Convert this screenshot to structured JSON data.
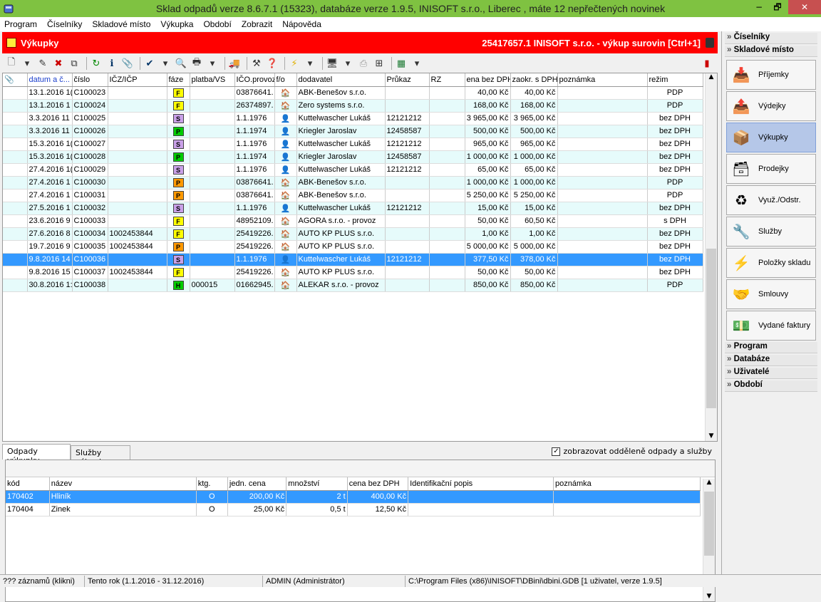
{
  "window": {
    "title": "Sklad odpadů verze 8.6.7.1 (15323), databáze verze 1.9.5, INISOFT s.r.o., Liberec , máte 12 nepřečtených novinek",
    "min": "−",
    "max": "🗗",
    "close": "✕"
  },
  "menu": [
    "Program",
    "Číselníky",
    "Skladové místo",
    "Výkupka",
    "Období",
    "Zobrazit",
    "Nápověda"
  ],
  "header": {
    "title": "Výkupky",
    "right": "25417657.1 INISOFT s.r.o. - výkup surovin [Ctrl+1]"
  },
  "colors": {
    "accent": "#ff0000",
    "titlebar": "#7fc241",
    "selection": "#3399ff",
    "alt_row": "#e6fbfb"
  },
  "grid": {
    "columns": [
      "datum a č...",
      "číslo",
      "IČZ/IČP",
      "fáze",
      "platba/VS",
      "IČO.provoz",
      "f/o",
      "dodavatel",
      "Průkaz",
      "RZ",
      "ena bez DPH",
      "zaokr. s DPH",
      "poznámka",
      "režim"
    ],
    "rows": [
      {
        "date": "13.1.2016 1(",
        "num": "C100023",
        "icz": "",
        "phase": "F",
        "pc": "#ffff00",
        "vs": "",
        "ico": "03876641.",
        "fo": "🏠",
        "sup": "ABK-Benešov s.r.o.",
        "pr": "",
        "rz": "",
        "net": "40,00 Kč",
        "gross": "40,00 Kč",
        "note": "",
        "mode": "PDP"
      },
      {
        "date": "13.1.2016 1",
        "num": "C100024",
        "icz": "",
        "phase": "F",
        "pc": "#ffff00",
        "vs": "",
        "ico": "26374897.",
        "fo": "🏠",
        "sup": "Zero systems s.r.o.",
        "pr": "",
        "rz": "",
        "net": "168,00 Kč",
        "gross": "168,00 Kč",
        "note": "",
        "mode": "PDP"
      },
      {
        "date": "3.3.2016 11",
        "num": "C100025",
        "icz": "",
        "phase": "S",
        "pc": "#c9a0e8",
        "vs": "",
        "ico": "1.1.1976",
        "fo": "👤",
        "sup": "Kuttelwascher Lukáš",
        "pr": "12121212",
        "rz": "",
        "net": "3 965,00 Kč",
        "gross": "3 965,00 Kč",
        "note": "",
        "mode": "bez DPH"
      },
      {
        "date": "3.3.2016 11",
        "num": "C100026",
        "icz": "",
        "phase": "P",
        "pc": "#00cc00",
        "vs": "",
        "ico": "1.1.1974",
        "fo": "👤",
        "sup": "Kriegler Jaroslav",
        "pr": "12458587",
        "rz": "",
        "net": "500,00 Kč",
        "gross": "500,00 Kč",
        "note": "",
        "mode": "bez DPH"
      },
      {
        "date": "15.3.2016 1(",
        "num": "C100027",
        "icz": "",
        "phase": "S",
        "pc": "#c9a0e8",
        "vs": "",
        "ico": "1.1.1976",
        "fo": "👤",
        "sup": "Kuttelwascher Lukáš",
        "pr": "12121212",
        "rz": "",
        "net": "965,00 Kč",
        "gross": "965,00 Kč",
        "note": "",
        "mode": "bez DPH"
      },
      {
        "date": "15.3.2016 1(",
        "num": "C100028",
        "icz": "",
        "phase": "P",
        "pc": "#00cc00",
        "vs": "",
        "ico": "1.1.1974",
        "fo": "👤",
        "sup": "Kriegler Jaroslav",
        "pr": "12458587",
        "rz": "",
        "net": "1 000,00 Kč",
        "gross": "1 000,00 Kč",
        "note": "",
        "mode": "bez DPH"
      },
      {
        "date": "27.4.2016 1(",
        "num": "C100029",
        "icz": "",
        "phase": "S",
        "pc": "#c9a0e8",
        "vs": "",
        "ico": "1.1.1976",
        "fo": "👤",
        "sup": "Kuttelwascher Lukáš",
        "pr": "12121212",
        "rz": "",
        "net": "65,00 Kč",
        "gross": "65,00 Kč",
        "note": "",
        "mode": "bez DPH"
      },
      {
        "date": "27.4.2016 1",
        "num": "C100030",
        "icz": "",
        "phase": "P",
        "pc": "#ff9900",
        "vs": "",
        "ico": "03876641.",
        "fo": "🏠",
        "sup": "ABK-Benešov s.r.o.",
        "pr": "",
        "rz": "",
        "net": "1 000,00 Kč",
        "gross": "1 000,00 Kč",
        "note": "",
        "mode": "PDP"
      },
      {
        "date": "27.4.2016 1",
        "num": "C100031",
        "icz": "",
        "phase": "P",
        "pc": "#ff9900",
        "vs": "",
        "ico": "03876641.",
        "fo": "🏠",
        "sup": "ABK-Benešov s.r.o.",
        "pr": "",
        "rz": "",
        "net": "5 250,00 Kč",
        "gross": "5 250,00 Kč",
        "note": "",
        "mode": "PDP"
      },
      {
        "date": "27.5.2016 1",
        "num": "C100032",
        "icz": "",
        "phase": "S",
        "pc": "#c9a0e8",
        "vs": "",
        "ico": "1.1.1976",
        "fo": "👤",
        "sup": "Kuttelwascher Lukáš",
        "pr": "12121212",
        "rz": "",
        "net": "15,00 Kč",
        "gross": "15,00 Kč",
        "note": "",
        "mode": "bez DPH"
      },
      {
        "date": "23.6.2016 9",
        "num": "C100033",
        "icz": "",
        "phase": "F",
        "pc": "#ffff00",
        "vs": "",
        "ico": "48952109.",
        "fo": "🏠",
        "sup": "AGORA s.r.o. - provoz",
        "pr": "",
        "rz": "",
        "net": "50,00 Kč",
        "gross": "60,50 Kč",
        "note": "",
        "mode": "s DPH"
      },
      {
        "date": "27.6.2016 8",
        "num": "C100034",
        "icz": "1002453844",
        "phase": "F",
        "pc": "#ffff00",
        "vs": "",
        "ico": "25419226.",
        "fo": "🏠",
        "sup": "AUTO KP PLUS s.r.o.",
        "pr": "",
        "rz": "",
        "net": "1,00 Kč",
        "gross": "1,00 Kč",
        "note": "",
        "mode": "bez DPH"
      },
      {
        "date": "19.7.2016 9",
        "num": "C100035",
        "icz": "1002453844",
        "phase": "P",
        "pc": "#ff9900",
        "vs": "",
        "ico": "25419226.",
        "fo": "🏠",
        "sup": "AUTO KP PLUS s.r.o.",
        "pr": "",
        "rz": "",
        "net": "5 000,00 Kč",
        "gross": "5 000,00 Kč",
        "note": "",
        "mode": "bez DPH"
      },
      {
        "date": "9.8.2016 14",
        "num": "C100036",
        "icz": "",
        "phase": "S",
        "pc": "#c9a0e8",
        "vs": "",
        "ico": "1.1.1976",
        "fo": "👤",
        "sup": "Kuttelwascher Lukáš",
        "pr": "12121212",
        "rz": "",
        "net": "377,50 Kč",
        "gross": "378,00 Kč",
        "note": "",
        "mode": "bez DPH",
        "selected": true
      },
      {
        "date": "9.8.2016 15",
        "num": "C100037",
        "icz": "1002453844",
        "phase": "F",
        "pc": "#ffff00",
        "vs": "",
        "ico": "25419226.",
        "fo": "🏠",
        "sup": "AUTO KP PLUS s.r.o.",
        "pr": "",
        "rz": "",
        "net": "50,00 Kč",
        "gross": "50,00 Kč",
        "note": "",
        "mode": "bez DPH"
      },
      {
        "date": "30.8.2016 1:",
        "num": "C100038",
        "icz": "",
        "phase": "H",
        "pc": "#00cc00",
        "vs": "000015",
        "ico": "01662945.",
        "fo": "🏠",
        "sup": "ALEKAR s.r.o. - provoz",
        "pr": "",
        "rz": "",
        "net": "850,00 Kč",
        "gross": "850,00 Kč",
        "note": "",
        "mode": "PDP"
      }
    ]
  },
  "tabs": [
    "Odpady výkupky",
    "Služby výkupky"
  ],
  "checkbox": {
    "label": "zobrazovat odděleně odpady a služby",
    "checked": "✓"
  },
  "grid2": {
    "columns": [
      "kód",
      "název",
      "ktg.",
      "jedn. cena",
      "množství",
      "cena bez DPH",
      "Identifikační popis",
      "poznámka"
    ],
    "rows": [
      {
        "code": "170402",
        "name": "Hliník",
        "ktg": "O",
        "unit": "200,00 Kč",
        "qty": "2 t",
        "net": "400,00 Kč",
        "id": "",
        "note": "",
        "selected": true
      },
      {
        "code": "170404",
        "name": "Zinek",
        "ktg": "O",
        "unit": "25,00 Kč",
        "qty": "0,5 t",
        "net": "12,50 Kč",
        "id": "",
        "note": ""
      }
    ]
  },
  "sidebar": {
    "sections_top": [
      "Číselníky",
      "Skladové místo"
    ],
    "buttons": [
      {
        "label": "Příjemky",
        "icon": "📥"
      },
      {
        "label": "Výdejky",
        "icon": "📤"
      },
      {
        "label": "Výkupky",
        "icon": "📦",
        "active": true
      },
      {
        "label": "Prodejky",
        "icon": "🗃"
      },
      {
        "label": "Využ./Odstr.",
        "icon": "♻"
      },
      {
        "label": "Služby",
        "icon": "🔧"
      },
      {
        "label": "Položky skladu",
        "icon": "⚡"
      },
      {
        "label": "Smlouvy",
        "icon": "🤝"
      },
      {
        "label": "Vydané faktury",
        "icon": "💵"
      }
    ],
    "sections_bottom": [
      "Program",
      "Databáze",
      "Uživatelé",
      "Období"
    ]
  },
  "status": [
    "??? záznamů (klikni)",
    "Tento rok (1.1.2016 - 31.12.2016)",
    "ADMIN (Administrátor)",
    "C:\\Program Files (x86)\\INISOFT\\DBini\\dbini.GDB [1 uživatel, verze 1.9.5]"
  ]
}
